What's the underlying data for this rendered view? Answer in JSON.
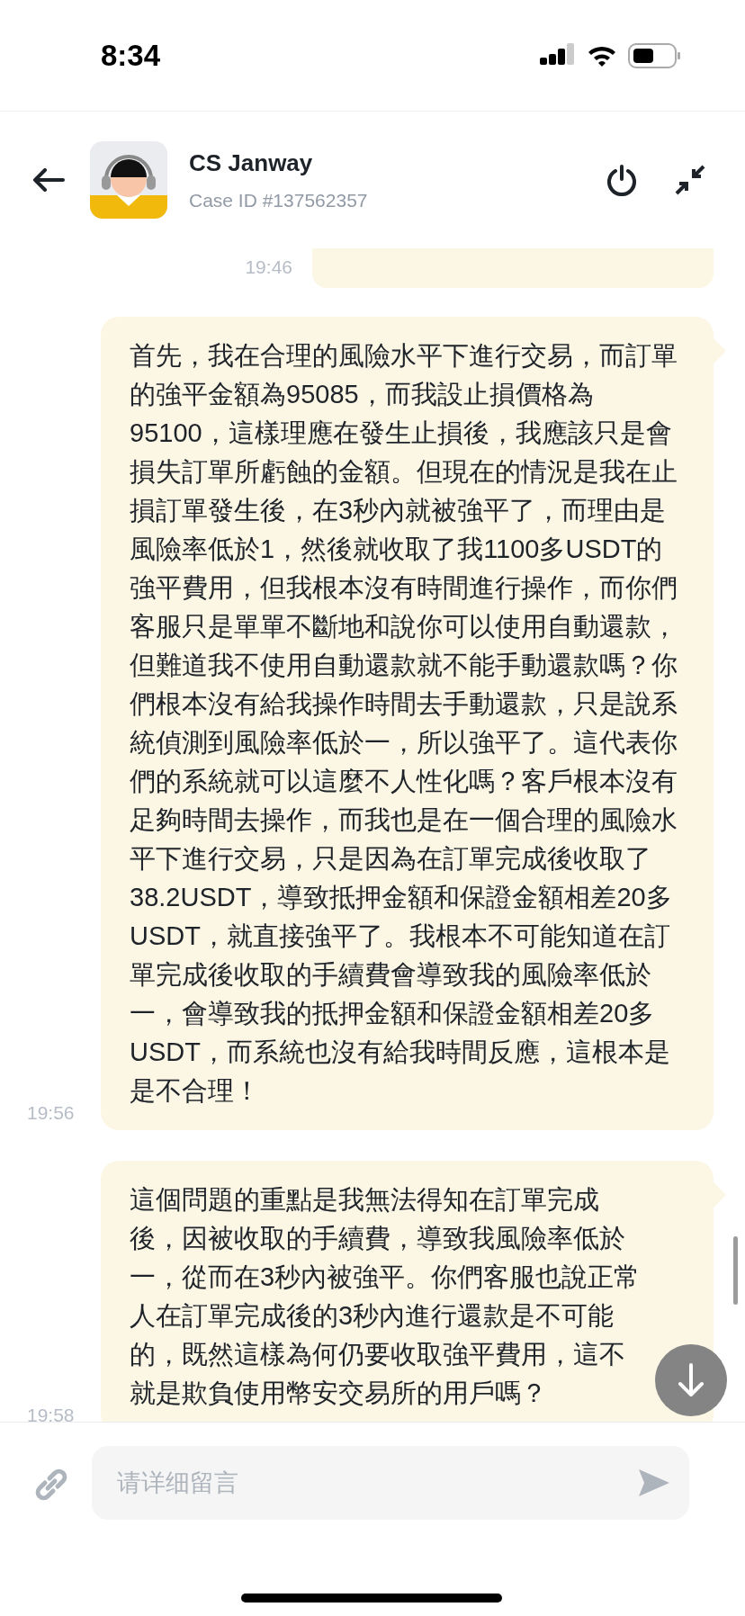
{
  "status_bar": {
    "time": "8:34"
  },
  "header": {
    "name": "CS Janway",
    "case_id": "Case ID #137562357"
  },
  "messages": [
    {
      "kind": "clipped",
      "time": "19:46"
    },
    {
      "kind": "text",
      "time": "19:56",
      "text": "首先，我在合理的風險水平下進行交易，而訂單的強平金額為95085，而我設止損價格為95100，這樣理應在發生止損後，我應該只是會損失訂單所虧蝕的金額。但現在的情況是我在止損訂單發生後，在3秒內就被強平了，而理由是風險率低於1，然後就收取了我1100多USDT的強平費用，但我根本沒有時間進行操作，而你們客服只是單單不斷地和說你可以使用自動還款，但難道我不使用自動還款就不能手動還款嗎？你們根本沒有給我操作時間去手動還款，只是說系統偵測到風險率低於一，所以強平了。這代表你們的系統就可以這麼不人性化嗎？客戶根本沒有足夠時間去操作，而我也是在一個合理的風險水平下進行交易，只是因為在訂單完成後收取了38.2USDT，導致抵押金額和保證金額相差20多USDT，就直接強平了。我根本不可能知道在訂單完成後收取的手續費會導致我的風險率低於一，會導致我的抵押金額和保證金額相差20多USDT，而系統也沒有給我時間反應，這根本是是不合理！"
    },
    {
      "kind": "text",
      "time": "19:58",
      "text": "這個問題的重點是我無法得知在訂單完成後，因被收取的手續費，導致我風險率低於一，從而在3秒內被強平。你們客服也說正常人在訂單完成後的3秒內進行還款是不可能的，既然這樣為何仍要收取強平費用，這不就是欺負使用幣安交易所的用戶嗎？"
    }
  ],
  "composer": {
    "placeholder": "请详细留言"
  }
}
